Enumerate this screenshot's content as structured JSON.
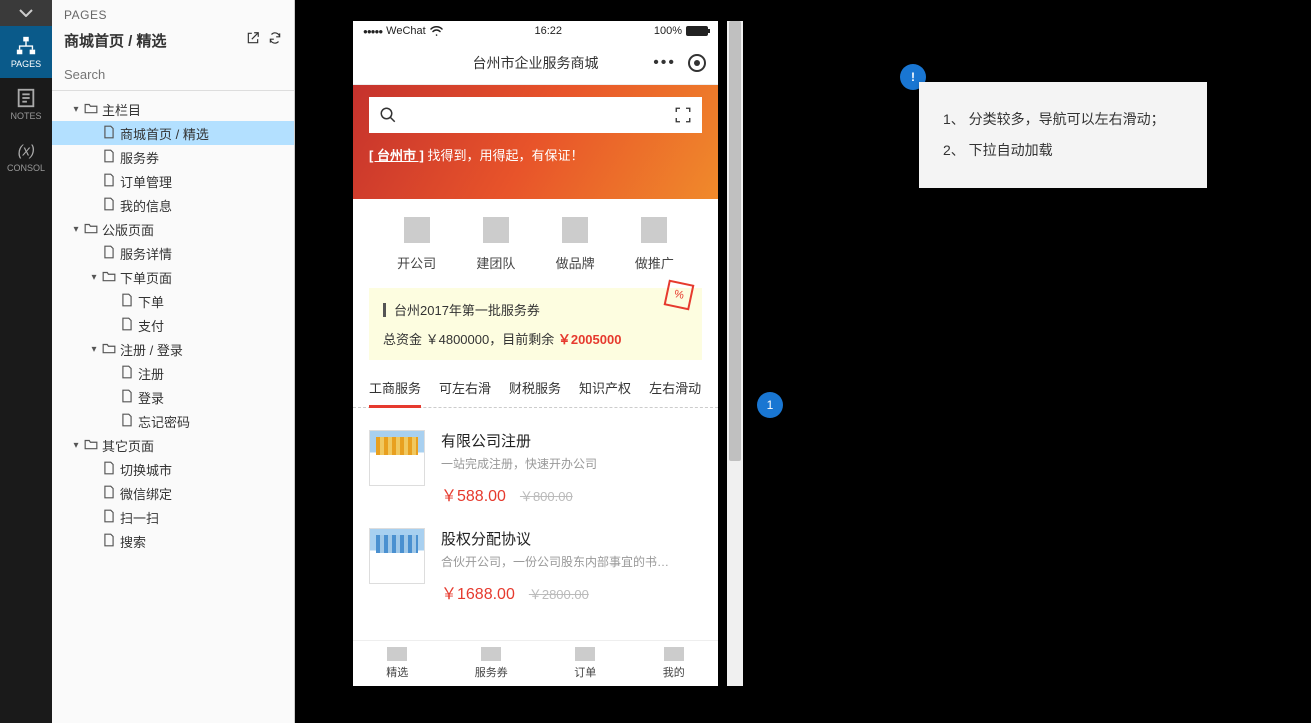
{
  "rail": {
    "pages": "PAGES",
    "notes": "NOTES",
    "console": "CONSOL"
  },
  "sidebar": {
    "title": "PAGES",
    "path": "商城首页 / 精选",
    "search_placeholder": "Search",
    "tree": [
      {
        "label": "主栏目",
        "type": "folder",
        "indent": 1,
        "expanded": true
      },
      {
        "label": "商城首页 / 精选",
        "type": "page",
        "indent": 2,
        "selected": true
      },
      {
        "label": "服务券",
        "type": "page",
        "indent": 2
      },
      {
        "label": "订单管理",
        "type": "page",
        "indent": 2
      },
      {
        "label": "我的信息",
        "type": "page",
        "indent": 2
      },
      {
        "label": "公版页面",
        "type": "folder",
        "indent": 1,
        "expanded": true
      },
      {
        "label": "服务详情",
        "type": "page",
        "indent": 2
      },
      {
        "label": "下单页面",
        "type": "folder",
        "indent": 2,
        "expanded": true
      },
      {
        "label": "下单",
        "type": "page",
        "indent": 3
      },
      {
        "label": "支付",
        "type": "page",
        "indent": 3
      },
      {
        "label": "注册 / 登录",
        "type": "folder",
        "indent": 2,
        "expanded": true
      },
      {
        "label": "注册",
        "type": "page",
        "indent": 3
      },
      {
        "label": "登录",
        "type": "page",
        "indent": 3
      },
      {
        "label": "忘记密码",
        "type": "page",
        "indent": 3
      },
      {
        "label": "其它页面",
        "type": "folder",
        "indent": 1,
        "expanded": true
      },
      {
        "label": "切换城市",
        "type": "page",
        "indent": 2
      },
      {
        "label": "微信绑定",
        "type": "page",
        "indent": 2
      },
      {
        "label": "扫一扫",
        "type": "page",
        "indent": 2
      },
      {
        "label": "搜索",
        "type": "page",
        "indent": 2
      }
    ]
  },
  "phone": {
    "status": {
      "carrier": "WeChat",
      "time": "16:22",
      "battery": "100%"
    },
    "topbar_title": "台州市企业服务商城",
    "banner": {
      "city_label": "[ 台州市 ]",
      "slogan": "  找得到，用得起，有保证！"
    },
    "categories": [
      "开公司",
      "建团队",
      "做品牌",
      "做推广"
    ],
    "voucher": {
      "title": "台州2017年第一批服务券",
      "sub_prefix": "总资金 ￥4800000，目前剩余 ",
      "remain": "￥2005000",
      "ticket_symbol": "%"
    },
    "tabs": [
      "工商服务",
      "可左右滑",
      "财税服务",
      "知识产权",
      "左右滑动"
    ],
    "products": [
      {
        "title": "有限公司注册",
        "desc": "一站完成注册，快速开办公司",
        "price": "￥588.00",
        "old": "￥800.00"
      },
      {
        "title": "股权分配协议",
        "desc": "合伙开公司，一份公司股东内部事宜的书…",
        "price": "￥1688.00",
        "old": "￥2800.00"
      }
    ],
    "bottom_nav": [
      "精选",
      "服务券",
      "订单",
      "我的"
    ]
  },
  "markers": {
    "m1": "1",
    "m2": "!"
  },
  "note": {
    "line1": "1、 分类较多，导航可以左右滑动；",
    "line2": "2、 下拉自动加载"
  }
}
